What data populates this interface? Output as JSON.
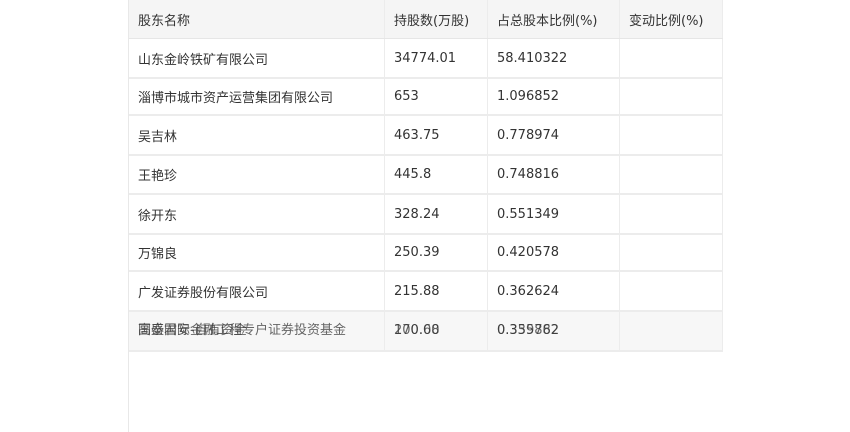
{
  "table": {
    "headers": [
      "股东名称",
      "持股数(万股)",
      "占总股本比例(%)",
      "变动比例(%)"
    ],
    "rows": [
      [
        "山东金岭铁矿有限公司",
        "34774.01",
        "58.410322",
        ""
      ],
      [
        "淄博市城市资产运营集团有限公司",
        "653",
        "1.096852",
        ""
      ],
      [
        "吴吉林",
        "463.75",
        "0.778974",
        ""
      ],
      [
        "王艳珍",
        "445.8",
        "0.748816",
        ""
      ],
      [
        "徐开东",
        "328.24",
        "0.551349",
        ""
      ],
      [
        "万锦良",
        "250.39",
        "0.420578",
        ""
      ],
      [
        "广发证券股份有限公司",
        "215.88",
        "0.362624",
        ""
      ]
    ],
    "overlap_row": {
      "name_a": "高盛国际-自有资金",
      "name_b": "国泰君安金融工程专户证券投资基金",
      "shares_a": "170.68",
      "shares_b": "200.00",
      "ratio_a": "0.335882",
      "ratio_b": "0.359762"
    }
  }
}
